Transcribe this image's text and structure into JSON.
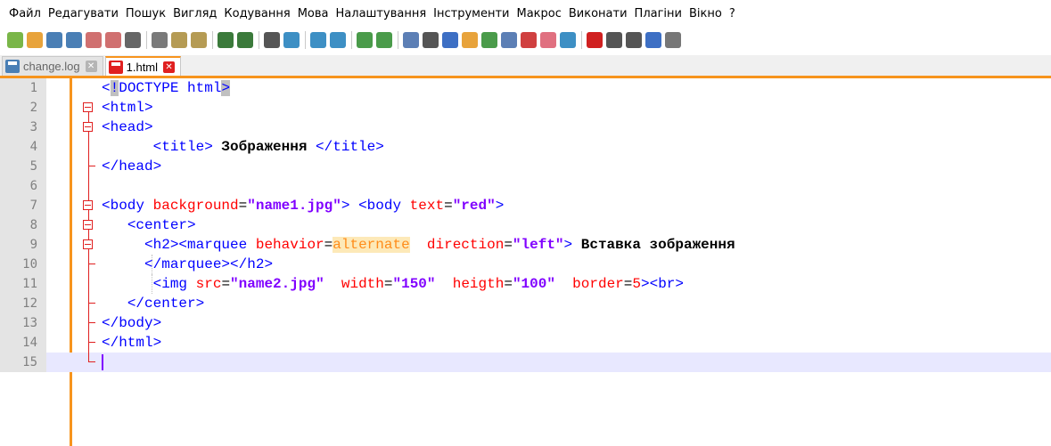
{
  "menu": [
    "Файл",
    "Редагувати",
    "Пошук",
    "Вигляд",
    "Кодування",
    "Мова",
    "Налаштування",
    "Інструменти",
    "Макрос",
    "Виконати",
    "Плагіни",
    "Вікно",
    "?"
  ],
  "toolbar": {
    "icons": [
      {
        "name": "new-file-icon",
        "color": "#7ab648"
      },
      {
        "name": "open-file-icon",
        "color": "#e8a33b"
      },
      {
        "name": "save-icon",
        "color": "#4a7fb5"
      },
      {
        "name": "save-all-icon",
        "color": "#4a7fb5"
      },
      {
        "name": "close-icon",
        "color": "#d07070"
      },
      {
        "name": "close-all-icon",
        "color": "#d07070"
      },
      {
        "name": "print-icon",
        "color": "#666666"
      },
      {
        "sep": true
      },
      {
        "name": "cut-icon",
        "color": "#7a7a7a"
      },
      {
        "name": "copy-icon",
        "color": "#b59b54"
      },
      {
        "name": "paste-icon",
        "color": "#b59b54"
      },
      {
        "sep": true
      },
      {
        "name": "undo-icon",
        "color": "#3b7a3b"
      },
      {
        "name": "redo-icon",
        "color": "#3b7a3b"
      },
      {
        "sep": true
      },
      {
        "name": "find-icon",
        "color": "#555555"
      },
      {
        "name": "replace-icon",
        "color": "#3d8fc4"
      },
      {
        "sep": true
      },
      {
        "name": "zoom-in-icon",
        "color": "#3d8fc4"
      },
      {
        "name": "zoom-out-icon",
        "color": "#3d8fc4"
      },
      {
        "sep": true
      },
      {
        "name": "sync-vertical-icon",
        "color": "#4a9b4a"
      },
      {
        "name": "sync-horizontal-icon",
        "color": "#4a9b4a"
      },
      {
        "sep": true
      },
      {
        "name": "word-wrap-icon",
        "color": "#5c7fb5"
      },
      {
        "name": "show-all-chars-icon",
        "color": "#555555"
      },
      {
        "name": "indent-guide-icon",
        "color": "#3d6fc4"
      },
      {
        "name": "udl-icon",
        "color": "#e8a33b"
      },
      {
        "name": "document-map-icon",
        "color": "#4a9b4a"
      },
      {
        "name": "function-list-icon",
        "color": "#5c7fb5"
      },
      {
        "name": "folder-workspace-icon",
        "color": "#d04040"
      },
      {
        "name": "folder-icon",
        "color": "#e07080"
      },
      {
        "name": "monitor-icon",
        "color": "#3d8fc4"
      },
      {
        "sep": true
      },
      {
        "name": "record-macro-icon",
        "color": "#d02020"
      },
      {
        "name": "stop-macro-icon",
        "color": "#555555"
      },
      {
        "name": "play-macro-icon",
        "color": "#555555"
      },
      {
        "name": "run-macro-multiple-icon",
        "color": "#3d6fc4"
      },
      {
        "name": "save-macro-icon",
        "color": "#777777"
      }
    ]
  },
  "tabs": [
    {
      "label": "change.log",
      "active": false
    },
    {
      "label": "1.html",
      "active": true
    }
  ],
  "editor": {
    "current_line": 15,
    "lines": [
      {
        "n": "1",
        "fold": "none",
        "indent": "",
        "tokens": [
          [
            "tag",
            "<"
          ],
          [
            "tag-hl",
            "!"
          ],
          [
            "tag",
            "DOCTYPE html"
          ],
          [
            "tag-hl",
            ">"
          ]
        ]
      },
      {
        "n": "2",
        "fold": "open",
        "indent": "",
        "tokens": [
          [
            "tag",
            "<html>"
          ]
        ]
      },
      {
        "n": "3",
        "fold": "open",
        "indent": "",
        "tokens": [
          [
            "tag",
            "<head>"
          ]
        ]
      },
      {
        "n": "4",
        "fold": "line",
        "indent": "      ",
        "tokens": [
          [
            "tag",
            "<title>"
          ],
          [
            "txt",
            " Зображення "
          ],
          [
            "tag",
            "</title>"
          ]
        ]
      },
      {
        "n": "5",
        "fold": "end",
        "indent": "",
        "tokens": [
          [
            "tag",
            "</head>"
          ]
        ]
      },
      {
        "n": "6",
        "fold": "line",
        "indent": "",
        "tokens": []
      },
      {
        "n": "7",
        "fold": "open",
        "indent": "",
        "tokens": [
          [
            "tag",
            "<body "
          ],
          [
            "attr",
            "background"
          ],
          [
            "plain",
            "="
          ],
          [
            "str",
            "\"name1.jpg\""
          ],
          [
            "tag",
            "> <body "
          ],
          [
            "attr",
            "text"
          ],
          [
            "plain",
            "="
          ],
          [
            "str",
            "\"red\""
          ],
          [
            "tag",
            ">"
          ]
        ]
      },
      {
        "n": "8",
        "fold": "open",
        "indent": "   ",
        "tokens": [
          [
            "tag",
            "<center>"
          ]
        ]
      },
      {
        "n": "9",
        "fold": "open",
        "indent": "     ",
        "tokens": [
          [
            "tag",
            "<h2><marquee "
          ],
          [
            "attr",
            "behavior"
          ],
          [
            "plain",
            "="
          ],
          [
            "hl2",
            "alternate"
          ],
          [
            "plain",
            "  "
          ],
          [
            "attr",
            "direction"
          ],
          [
            "plain",
            "="
          ],
          [
            "str",
            "\"left\""
          ],
          [
            "tag",
            ">"
          ],
          [
            "txt",
            " Вставка зображення"
          ]
        ]
      },
      {
        "n": "10",
        "fold": "end",
        "indent": "     ",
        "tokens": [
          [
            "tag",
            "</marquee></h2>"
          ]
        ]
      },
      {
        "n": "11",
        "fold": "line",
        "indent": "      ",
        "tokens": [
          [
            "tag",
            "<img "
          ],
          [
            "attr",
            "src"
          ],
          [
            "plain",
            "="
          ],
          [
            "str",
            "\"name2.jpg\""
          ],
          [
            "plain",
            "  "
          ],
          [
            "attr",
            "width"
          ],
          [
            "plain",
            "="
          ],
          [
            "str",
            "\"150\""
          ],
          [
            "plain",
            "  "
          ],
          [
            "attr",
            "heigth"
          ],
          [
            "plain",
            "="
          ],
          [
            "str",
            "\"100\""
          ],
          [
            "plain",
            "  "
          ],
          [
            "attr",
            "border"
          ],
          [
            "plain",
            "="
          ],
          [
            "unq",
            "5"
          ],
          [
            "tag",
            "><br>"
          ]
        ]
      },
      {
        "n": "12",
        "fold": "end",
        "indent": "   ",
        "tokens": [
          [
            "tag",
            "</center>"
          ]
        ]
      },
      {
        "n": "13",
        "fold": "end",
        "indent": "",
        "tokens": [
          [
            "tag",
            "</body>"
          ]
        ]
      },
      {
        "n": "14",
        "fold": "end",
        "indent": "",
        "tokens": [
          [
            "tag",
            "</html>"
          ]
        ]
      },
      {
        "n": "15",
        "fold": "last",
        "indent": "",
        "tokens": []
      }
    ]
  }
}
